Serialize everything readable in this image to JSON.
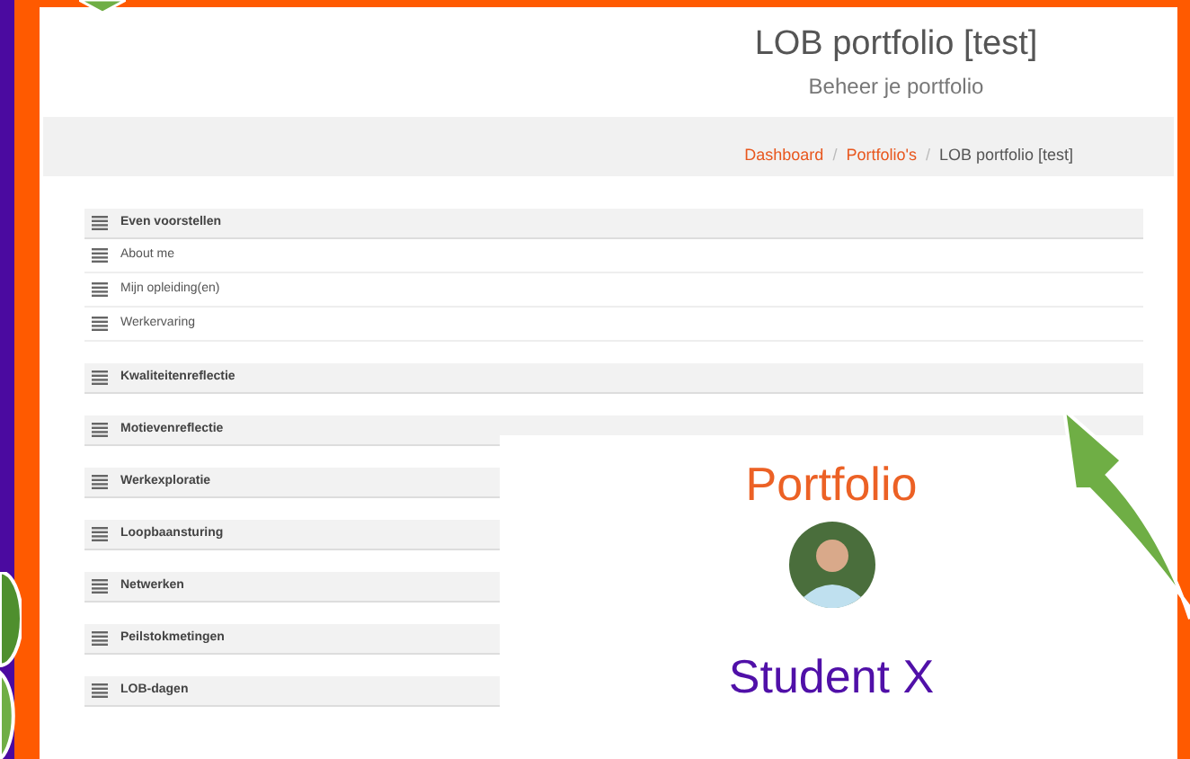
{
  "header": {
    "title": "LOB portfolio [test]",
    "subtitle": "Beheer je portfolio"
  },
  "breadcrumb": {
    "separator": "/",
    "items": [
      {
        "label": "Dashboard",
        "kind": "link"
      },
      {
        "label": "Portfolio's",
        "kind": "link"
      },
      {
        "label": "LOB portfolio [test]",
        "kind": "current"
      }
    ]
  },
  "sections": [
    {
      "label": "Even voorstellen",
      "children": [
        {
          "label": "About me"
        },
        {
          "label": "Mijn opleiding(en)"
        },
        {
          "label": "Werkervaring"
        }
      ]
    },
    {
      "label": "Kwaliteitenreflectie"
    },
    {
      "label": "Motievenreflectie"
    },
    {
      "label": "Werkexploratie"
    },
    {
      "label": "Loopbaansturing"
    },
    {
      "label": "Netwerken"
    },
    {
      "label": "Peilstokmetingen"
    },
    {
      "label": "LOB-dagen"
    }
  ],
  "overlay_card": {
    "title": "Portfolio",
    "name": "Student X"
  }
}
